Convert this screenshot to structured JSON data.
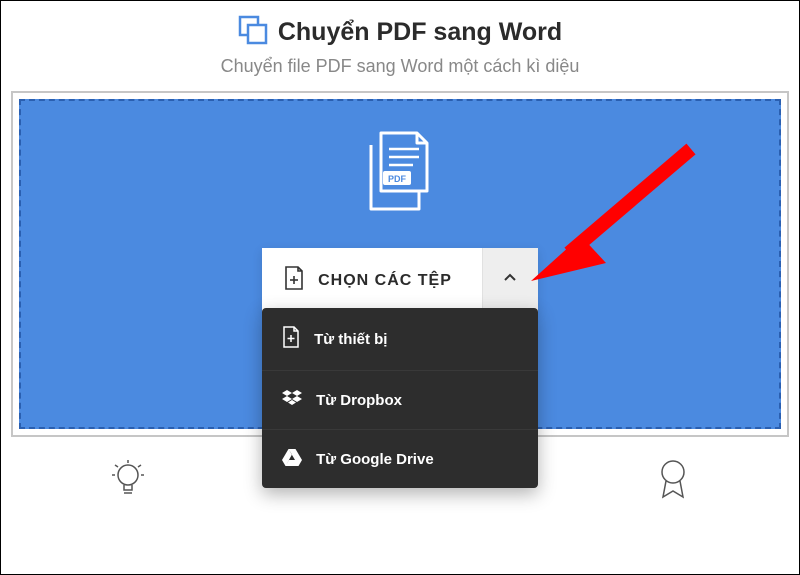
{
  "header": {
    "title": "Chuyển PDF sang Word",
    "subtitle": "Chuyển file PDF sang Word một cách kì diệu"
  },
  "choose": {
    "label": "CHỌN CÁC TỆP"
  },
  "dropdown": {
    "items": [
      {
        "label": "Từ thiết bị",
        "icon": "device"
      },
      {
        "label": "Từ Dropbox",
        "icon": "dropbox"
      },
      {
        "label": "Từ Google Drive",
        "icon": "gdrive"
      }
    ]
  },
  "colors": {
    "dropzone_bg": "#4b8ae0",
    "arrow": "#ff0000"
  }
}
